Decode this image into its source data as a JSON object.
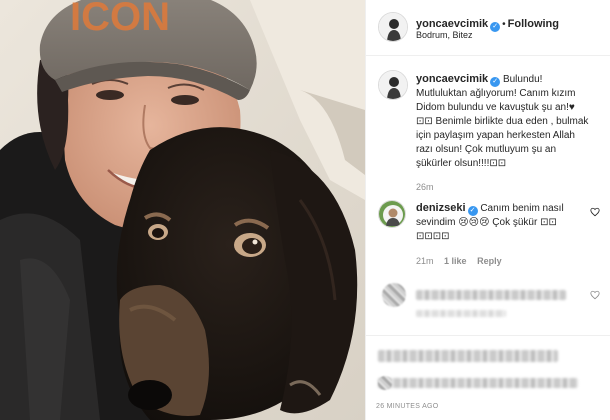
{
  "post": {
    "author": {
      "username": "yoncaevcimik",
      "verified": true,
      "follow_status": "Following",
      "location": "Bodrum, Bitez"
    },
    "image": {
      "description_icon": "selfie-photo-with-dog",
      "cap_text": "ICON"
    },
    "caption": {
      "username": "yoncaevcimik",
      "text_line1": "Bulundu!",
      "text_line2": "Mutluluktan ağlıyorum! Canım kızım",
      "text_line3": "Didom bulundu ve kavuştuk şu an!♥",
      "text_line4": "⊡⊡ Benimle birlikte dua eden , bulmak",
      "text_line5": "için paylaşım yapan herkesten Allah",
      "text_line6": "razı olsun! Çok mutluyum şu an",
      "text_line7": "şükürler olsun!!!!⊡⊡",
      "time_ago": "26m"
    },
    "comments": [
      {
        "username": "denizseki",
        "verified": true,
        "text_line1": "Canım benim nasıl",
        "text_line2": "sevindim 😢😢😢 Çok şükür ⊡⊡",
        "text_line3": "⊡⊡⊡⊡",
        "time_ago": "21m",
        "likes": "1 like",
        "reply_label": "Reply"
      }
    ],
    "timestamp": "26 MINUTES AGO"
  },
  "colors": {
    "accent": "#3897f0",
    "text": "#262626",
    "muted": "#8e8e8e",
    "divider": "#efefef"
  },
  "icons": {
    "verified": "verified-badge-icon",
    "more": "more-options-icon",
    "like": "heart-icon"
  }
}
